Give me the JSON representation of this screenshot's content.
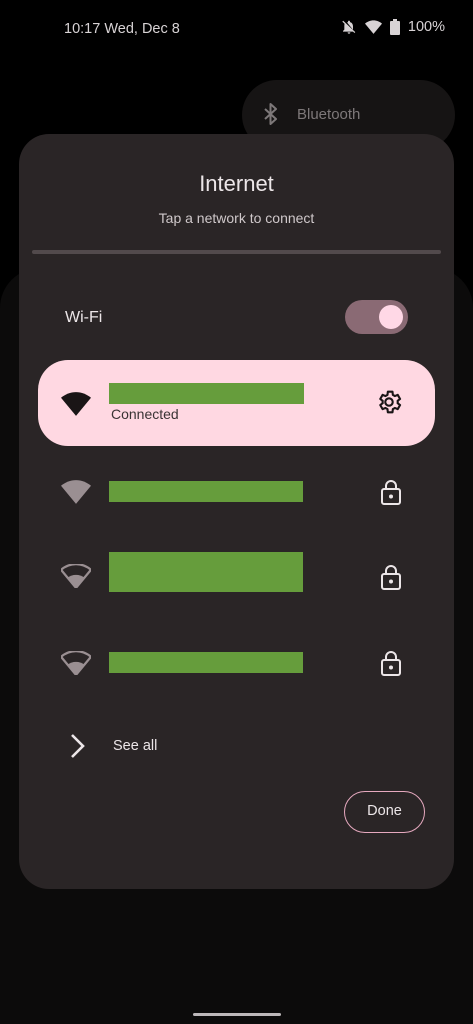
{
  "status_bar": {
    "time": "10:17",
    "date": "Wed, Dec 8",
    "battery": "100%",
    "icons": [
      "notifications-off-icon",
      "wifi-icon",
      "battery-icon"
    ]
  },
  "quick_settings": {
    "bluetooth_label": "Bluetooth"
  },
  "dialog": {
    "title": "Internet",
    "subtitle": "Tap a network to connect",
    "wifi_label": "Wi-Fi",
    "wifi_enabled": true,
    "connected_network": {
      "status": "Connected",
      "ssid_redacted": true,
      "icon": "wifi-full-icon",
      "action_icon": "gear-icon"
    },
    "networks": [
      {
        "ssid_redacted": true,
        "icon": "wifi-full-icon",
        "secured": true
      },
      {
        "ssid_redacted": true,
        "icon": "wifi-weak-icon",
        "secured": true
      },
      {
        "ssid_redacted": true,
        "icon": "wifi-weak-icon",
        "secured": true
      }
    ],
    "see_all_label": "See all",
    "done_label": "Done"
  },
  "colors": {
    "dialog_bg": "#2a2526",
    "connected_bg": "#ffd8e2",
    "redaction": "#669d3c",
    "toggle_track": "#8a6a74",
    "toggle_knob": "#ffd8e6",
    "done_border": "#e6a9bf"
  }
}
